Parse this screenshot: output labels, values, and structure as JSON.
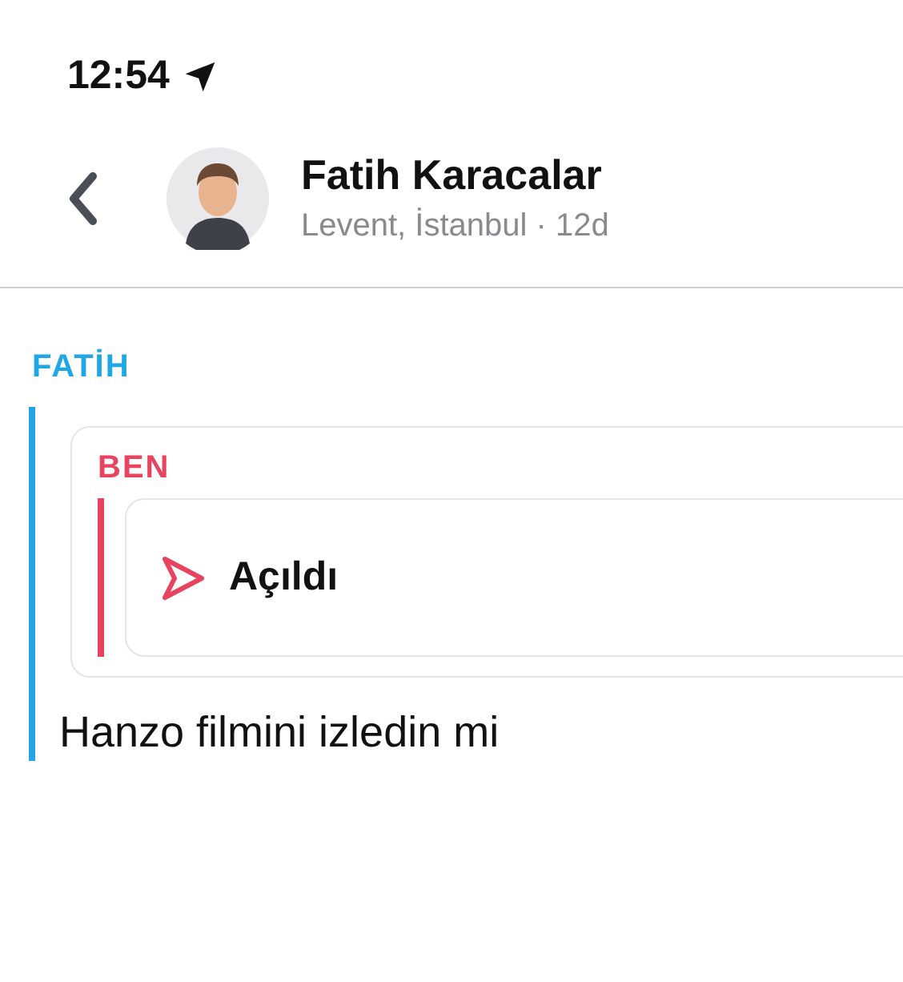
{
  "status_bar": {
    "time": "12:54"
  },
  "header": {
    "name": "Fatih Karacalar",
    "subtitle": "Levent, İstanbul · 12d"
  },
  "messages": [
    {
      "sender": "FATİH",
      "color": "#21a7e6",
      "quote": {
        "sender": "BEN",
        "color": "#e8445f",
        "status": "Açıldı"
      },
      "text": "Hanzo filmini izledin mi"
    }
  ]
}
